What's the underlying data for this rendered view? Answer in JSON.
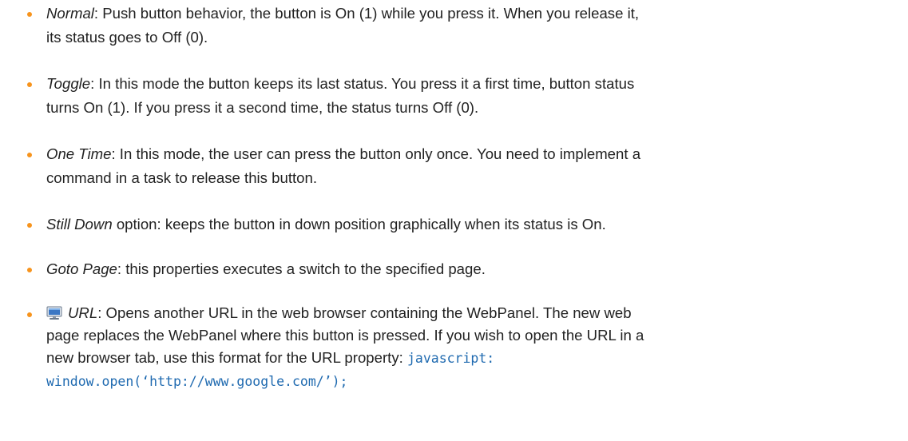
{
  "items": [
    {
      "term": "Normal",
      "line1": ": Push button behavior, the button is On (1) while you press it. When you release it,",
      "line2": "its status goes to Off (0)."
    },
    {
      "term": "Toggle",
      "line1": ": In this mode the button keeps its last status. You press it a first time, button status",
      "line2": "turns On (1). If you press it a second time, the status turns Off (0)."
    },
    {
      "term": "One Time",
      "line1": ": In this mode, the user can press the button only once. You need to implement a",
      "line2": "command in a task to release this button."
    },
    {
      "term": "Still Down",
      "line1": " option: keeps the button in down position graphically when its status is On."
    },
    {
      "term": "Goto Page",
      "line1": ": this properties executes a switch to the specified page."
    },
    {
      "icon": "monitor-icon",
      "term": "URL",
      "line1": ": Opens another URL in the web browser containing the WebPanel. The new web",
      "line2": "page replaces the WebPanel where this button is pressed. If you wish to open the URL in a",
      "line3": "new browser tab, use this format for the URL property: ",
      "code1": "javascript:",
      "code2": "window.open(‘http://www.google.com/’);"
    }
  ],
  "colors": {
    "bullet": "#f7941d",
    "code": "#1f6ab0",
    "text": "#222222"
  }
}
